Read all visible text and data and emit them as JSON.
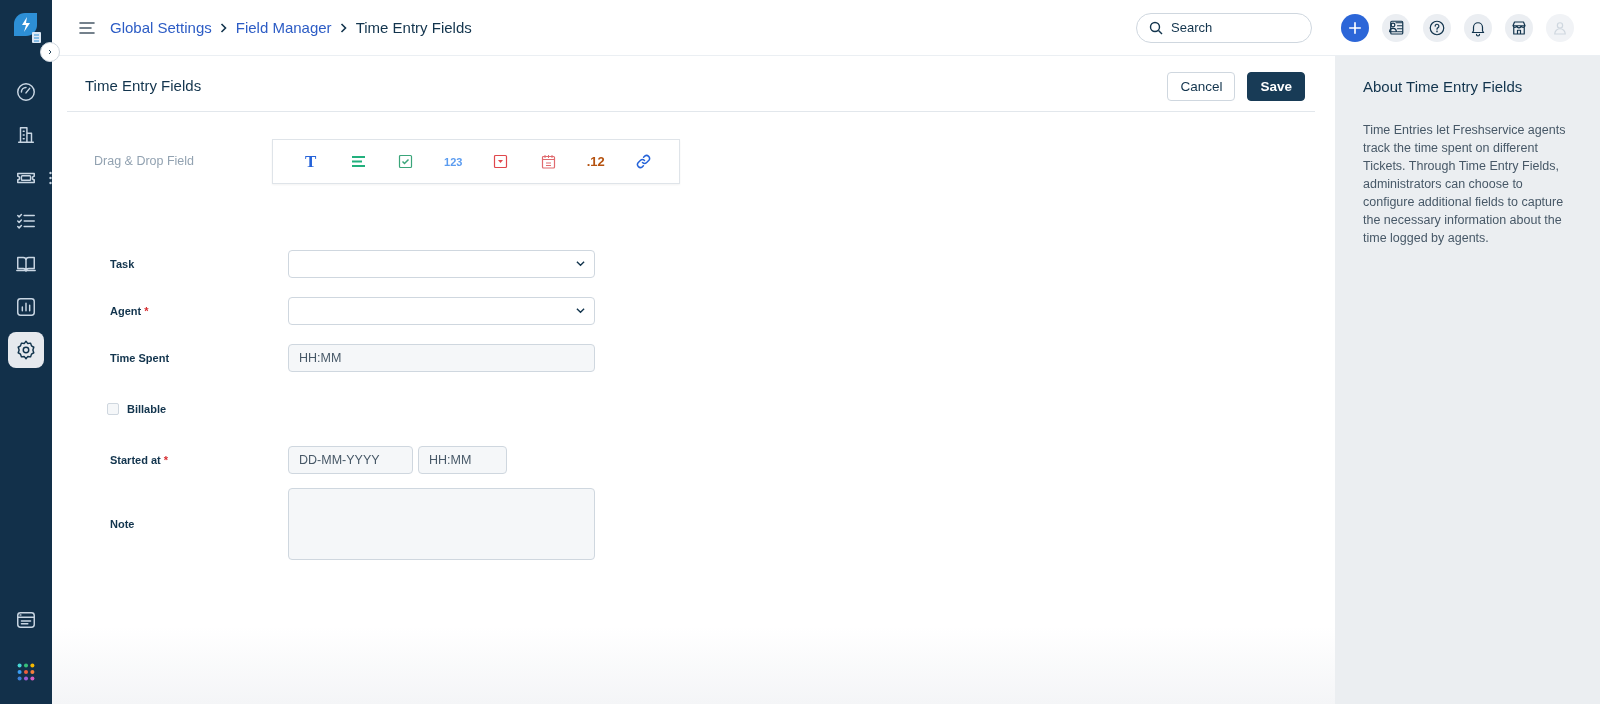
{
  "sidebar": {
    "items": [
      {
        "kind": "dashboard",
        "selected": false
      },
      {
        "kind": "building",
        "selected": false
      },
      {
        "kind": "ticket",
        "selected": false
      },
      {
        "kind": "checklist",
        "selected": false
      },
      {
        "kind": "book",
        "selected": false
      },
      {
        "kind": "report",
        "selected": false
      },
      {
        "kind": "settings",
        "selected": true
      }
    ],
    "bottom_items": [
      {
        "kind": "window"
      },
      {
        "kind": "apps"
      }
    ]
  },
  "breadcrumb": [
    {
      "label": "Global Settings",
      "link": true
    },
    {
      "label": "Field Manager",
      "link": true
    },
    {
      "label": "Time Entry Fields",
      "link": false
    }
  ],
  "search": {
    "placeholder": "Search"
  },
  "header_actions": [
    {
      "kind": "add"
    },
    {
      "kind": "contacts"
    },
    {
      "kind": "help"
    },
    {
      "kind": "bell"
    },
    {
      "kind": "store"
    },
    {
      "kind": "avatar"
    }
  ],
  "page": {
    "title": "Time Entry Fields",
    "buttons": [
      {
        "label": "Cancel",
        "kind": "secondary"
      },
      {
        "label": "Save",
        "kind": "primary"
      }
    ]
  },
  "palette": {
    "label": "Drag & Drop Field",
    "field_types": [
      {
        "kind": "text",
        "glyph": "T",
        "color": "#2563d9"
      },
      {
        "kind": "paragraph",
        "color": "#22b07d"
      },
      {
        "kind": "checkbox",
        "color": "#3aa57a"
      },
      {
        "kind": "number",
        "glyph": "123",
        "color": "#5b9cf0"
      },
      {
        "kind": "dropdown",
        "color": "#e0474c"
      },
      {
        "kind": "date",
        "color": "#e06a6e"
      },
      {
        "kind": "decimal",
        "glyph": ".12",
        "color": "#b5520f"
      },
      {
        "kind": "url",
        "color": "#2563d9"
      }
    ]
  },
  "form": {
    "fields": [
      {
        "label": "Task",
        "kind": "select"
      },
      {
        "label": "Agent",
        "kind": "select",
        "required_mark": "*"
      },
      {
        "label": "Time Spent",
        "kind": "input",
        "placeholder": "HH:MM"
      },
      {
        "label": "Billable",
        "kind": "checkbox",
        "checked": false
      },
      {
        "label": "Started at",
        "kind": "datetime",
        "required_mark": "*",
        "placeholders": [
          "DD-MM-YYYY",
          "HH:MM"
        ]
      },
      {
        "label": "Note",
        "kind": "textarea"
      }
    ]
  },
  "about": {
    "title": "About Time Entry Fields",
    "text": "Time Entries let Freshservice agents track the time spent on different Tickets. Through Time Entry Fields, administrators can choose to configure additional fields to capture the necessary information about the time logged by agents."
  }
}
